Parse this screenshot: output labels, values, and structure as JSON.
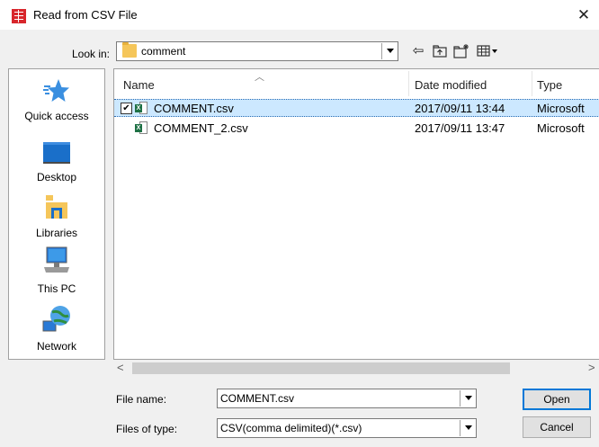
{
  "window": {
    "title": "Read from CSV File",
    "close": "✕"
  },
  "lookin": {
    "label": "Look in:",
    "value": "comment"
  },
  "toolbar": {
    "back_icon": "back-arrow-icon",
    "up_icon": "up-folder-icon",
    "new_icon": "new-folder-icon",
    "view_icon": "view-menu-icon"
  },
  "places": [
    {
      "label": "Quick access",
      "icon": "star-icon"
    },
    {
      "label": "Desktop",
      "icon": "desktop-icon"
    },
    {
      "label": "Libraries",
      "icon": "libraries-icon"
    },
    {
      "label": "This PC",
      "icon": "computer-icon"
    },
    {
      "label": "Network",
      "icon": "network-icon"
    }
  ],
  "filelist": {
    "columns": [
      "Name",
      "Date modified",
      "Type"
    ],
    "rows": [
      {
        "name": "COMMENT.csv",
        "date": "2017/09/11 13:44",
        "type": "Microsoft",
        "selected": true,
        "checked": "✔"
      },
      {
        "name": "COMMENT_2.csv",
        "date": "2017/09/11 13:47",
        "type": "Microsoft",
        "selected": false
      }
    ]
  },
  "scroll": {
    "left": "<",
    "right": ">"
  },
  "filename": {
    "label": "File name:",
    "value": "COMMENT.csv"
  },
  "filetype": {
    "label": "Files of type:",
    "value": "CSV(comma delimited)(*.csv)"
  },
  "buttons": {
    "open": "Open",
    "cancel": "Cancel"
  },
  "colors": {
    "selection": "#cce8ff",
    "app_icon": "#d8262c"
  }
}
